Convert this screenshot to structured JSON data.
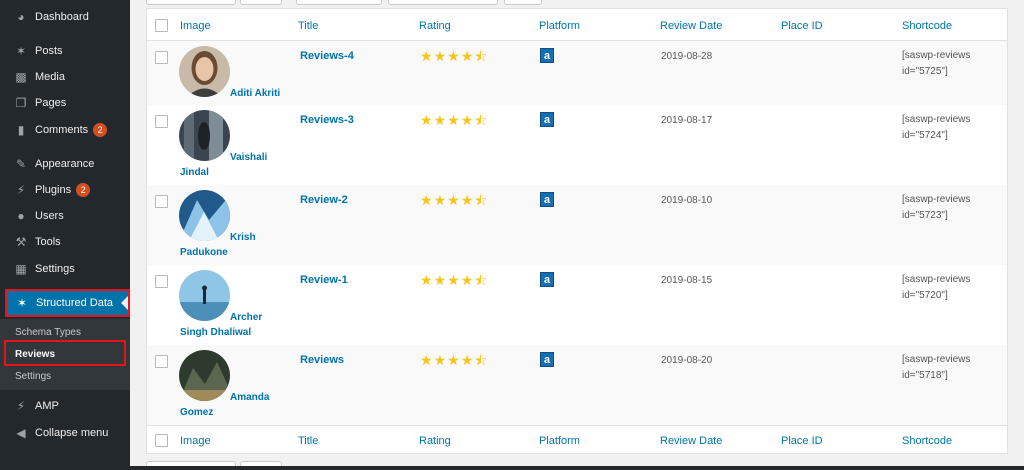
{
  "sidebar": {
    "items": [
      {
        "label": "Dashboard",
        "icon": "dashboard-icon"
      },
      {
        "label": "Posts",
        "icon": "pin-icon"
      },
      {
        "label": "Media",
        "icon": "media-icon"
      },
      {
        "label": "Pages",
        "icon": "pages-icon"
      },
      {
        "label": "Comments",
        "icon": "comments-icon",
        "badge": "2"
      },
      {
        "label": "Appearance",
        "icon": "appearance-icon"
      },
      {
        "label": "Plugins",
        "icon": "plugins-icon",
        "badge": "2"
      },
      {
        "label": "Users",
        "icon": "users-icon"
      },
      {
        "label": "Tools",
        "icon": "tools-icon"
      },
      {
        "label": "Settings",
        "icon": "settings-icon"
      },
      {
        "label": "Structured Data",
        "icon": "pin-icon"
      },
      {
        "label": "AMP",
        "icon": "amp-icon"
      },
      {
        "label": "Collapse menu",
        "icon": "collapse-icon"
      }
    ],
    "submenu": [
      "Schema Types",
      "Reviews",
      "Settings"
    ]
  },
  "table": {
    "columns": [
      "Image",
      "Title",
      "Rating",
      "Platform",
      "Review Date",
      "Place ID",
      "Shortcode"
    ],
    "rows": [
      {
        "author_line1": "Aditi Akriti",
        "author_line2": "",
        "title": "Reviews-4",
        "rating": 4.5,
        "platform": "a",
        "date": "2019-08-28",
        "place_id": "",
        "shortcode_line1": "[saswp-reviews",
        "shortcode_line2": "id=\"5725\"]"
      },
      {
        "author_line1": "Vaishali",
        "author_line2": "Jindal",
        "title": "Reviews-3",
        "rating": 4.5,
        "platform": "a",
        "date": "2019-08-17",
        "place_id": "",
        "shortcode_line1": "[saswp-reviews",
        "shortcode_line2": "id=\"5724\"]"
      },
      {
        "author_line1": "Krish",
        "author_line2": "Padukone",
        "title": "Review-2",
        "rating": 4.5,
        "platform": "a",
        "date": "2019-08-10",
        "place_id": "",
        "shortcode_line1": "[saswp-reviews",
        "shortcode_line2": "id=\"5723\"]"
      },
      {
        "author_line1": "Archer",
        "author_line2": "Singh Dhaliwal",
        "title": "Review-1",
        "rating": 4.5,
        "platform": "a",
        "date": "2019-08-15",
        "place_id": "",
        "shortcode_line1": "[saswp-reviews",
        "shortcode_line2": "id=\"5720\"]"
      },
      {
        "author_line1": "Amanda",
        "author_line2": "Gomez",
        "title": "Reviews",
        "rating": 4.5,
        "platform": "a",
        "date": "2019-08-20",
        "place_id": "",
        "shortcode_line1": "[saswp-reviews",
        "shortcode_line2": "id=\"5718\"]"
      }
    ]
  },
  "colors": {
    "sidebar": "#23282d",
    "active": "#0073aa",
    "highlight": "#e8141b",
    "link": "#0073aa",
    "star": "#f5c518",
    "badge": "#d54e21"
  }
}
